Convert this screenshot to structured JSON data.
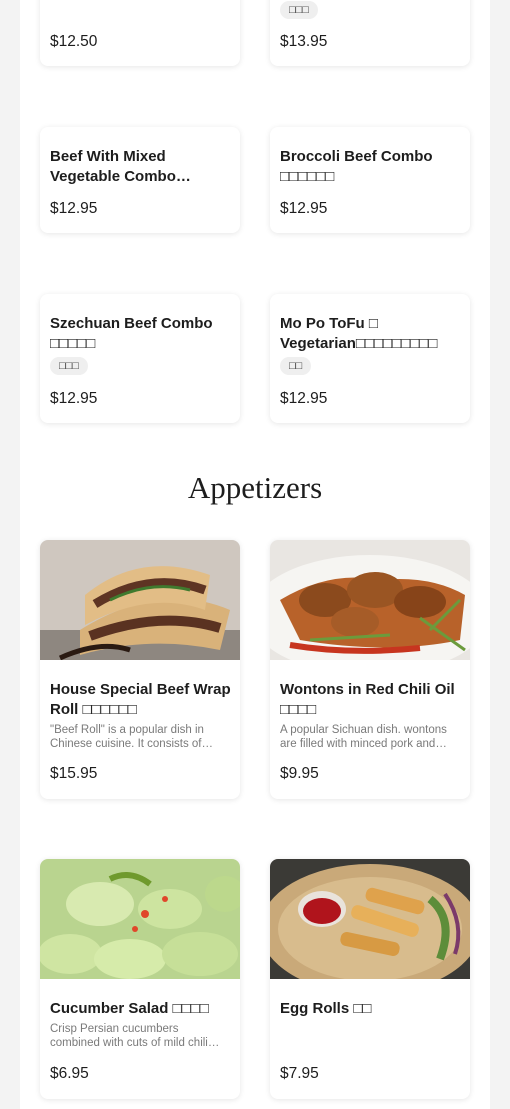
{
  "combos": [
    {
      "name": "",
      "tag": "",
      "price": "$12.50"
    },
    {
      "name": "",
      "tag": "□□□",
      "price": "$13.95"
    },
    {
      "name": "Beef With Mixed Vegetable Combo □□□□□□",
      "tag": "",
      "price": "$12.95"
    },
    {
      "name": "Broccoli Beef Combo □□□□□□",
      "tag": "",
      "price": "$12.95"
    },
    {
      "name": "Szechuan Beef Combo □□□□□",
      "tag": "□□□",
      "price": "$12.95"
    },
    {
      "name": "Mo Po ToFu □ Vegetarian□□□□□□□□□",
      "tag": "□□",
      "price": "$12.95"
    }
  ],
  "appetizers_title": "Appetizers",
  "appetizers": [
    {
      "name": "House Special Beef Wrap Roll □□□□□□",
      "desc": "\"Beef Roll\" is a popular dish in Chinese cuisine. It consists of thinly sliced beef wrapped in a pancake.",
      "price": "$15.95",
      "image_icon": "beef-roll-photo"
    },
    {
      "name": "Wontons in Red Chili Oil □□□□",
      "desc": "A popular Sichuan dish. wontons are filled with minced pork and served in red chili oil.",
      "price": "$9.95",
      "image_icon": "wontons-photo"
    },
    {
      "name": "Cucumber Salad □□□□",
      "desc": "Crisp Persian cucumbers combined with cuts of mild chili and garlic.",
      "price": "$6.95",
      "image_icon": "cucumber-salad-photo"
    },
    {
      "name": "Egg Rolls □□",
      "desc": "",
      "price": "$7.95",
      "image_icon": "egg-rolls-photo"
    }
  ]
}
